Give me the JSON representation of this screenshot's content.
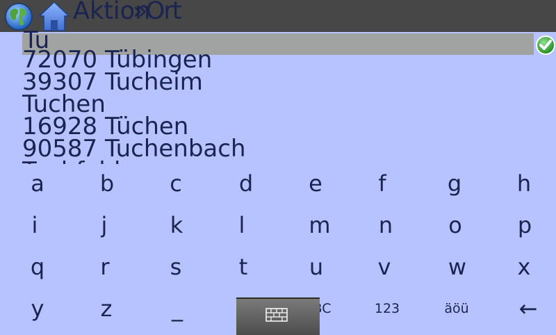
{
  "header": {
    "title": "Aktion",
    "overlay": "»Ort"
  },
  "search": {
    "value": "Tu"
  },
  "results": [
    "72070 Tübingen",
    "39307 Tucheim",
    "Tuchen",
    "16928 Tüchen",
    "90587 Tuchenbach",
    "Tuchfeld"
  ],
  "keyboard": {
    "rows": [
      [
        "a",
        "b",
        "c",
        "d",
        "e",
        "f",
        "g",
        "h"
      ],
      [
        "i",
        "j",
        "k",
        "l",
        "m",
        "n",
        "o",
        "p"
      ],
      [
        "q",
        "r",
        "s",
        "t",
        "u",
        "v",
        "w",
        "x"
      ],
      [
        "y",
        "z",
        "_",
        "",
        "ABC",
        "123",
        "äöü",
        "←"
      ]
    ]
  },
  "colors": {
    "background": "#b6c3ff",
    "topbar": "#474747",
    "searchbar": "#a0a3a2",
    "text": "#1b2350",
    "confirm": "#2ea02e"
  }
}
